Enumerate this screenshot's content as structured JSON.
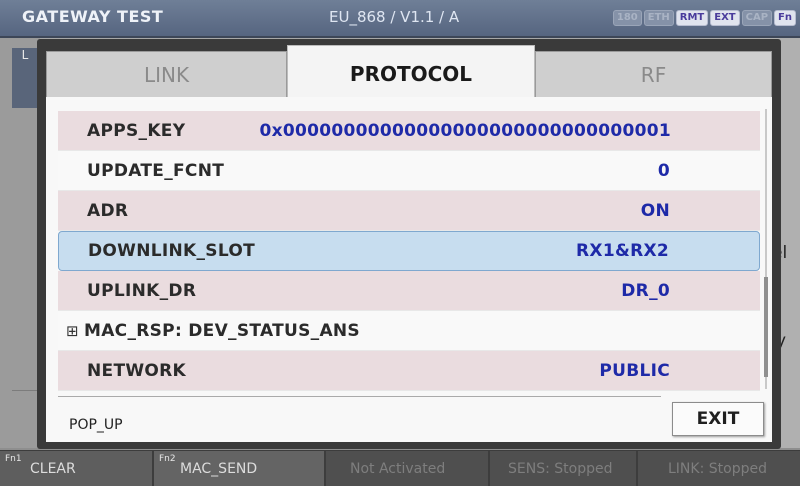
{
  "titlebar": {
    "left": "GATEWAY TEST",
    "mid": "EU_868 / V1.1 / A",
    "badges": [
      {
        "label": "180",
        "on": false
      },
      {
        "label": "ETH",
        "on": false
      },
      {
        "label": "RMT",
        "on": true
      },
      {
        "label": "EXT",
        "on": true
      },
      {
        "label": "CAP",
        "on": false
      },
      {
        "label": "Fn",
        "on": true
      }
    ]
  },
  "background": {
    "left_box": "L",
    "right_fragment_1": "el",
    "right_fragment_2": "y",
    "right_fragment_0": "."
  },
  "tabs": [
    {
      "label": "LINK",
      "active": false
    },
    {
      "label": "PROTOCOL",
      "active": true
    },
    {
      "label": "RF",
      "active": false
    }
  ],
  "rows": [
    {
      "label": "APPS_KEY",
      "value": "0x00000000000000000000000000000001",
      "style": "shade"
    },
    {
      "label": "UPDATE_FCNT",
      "value": "0",
      "style": "plain"
    },
    {
      "label": "ADR",
      "value": "ON",
      "style": "shade"
    },
    {
      "label": "DOWNLINK_SLOT",
      "value": "RX1&RX2",
      "style": "sel"
    },
    {
      "label": "UPLINK_DR",
      "value": "DR_0",
      "style": "shade"
    },
    {
      "label": "MAC_RSP: DEV_STATUS_ANS",
      "value": "",
      "style": "plain",
      "expand": "⊞"
    },
    {
      "label": "NETWORK",
      "value": "PUBLIC",
      "style": "shade"
    }
  ],
  "popup": {
    "status": "POP_UP",
    "exit_label": "EXIT"
  },
  "softkeys": [
    {
      "fn": "Fn1",
      "label": "CLEAR"
    },
    {
      "fn": "Fn2",
      "label": "MAC_SEND"
    },
    {
      "fn": "",
      "label": "Not Activated"
    },
    {
      "fn": "",
      "label": "SENS: Stopped"
    },
    {
      "fn": "",
      "label": "LINK: Stopped"
    }
  ],
  "colors": {
    "value_text": "#1e2aa8",
    "selected_row": "#c7ddef",
    "shaded_row": "#eadcdf"
  }
}
